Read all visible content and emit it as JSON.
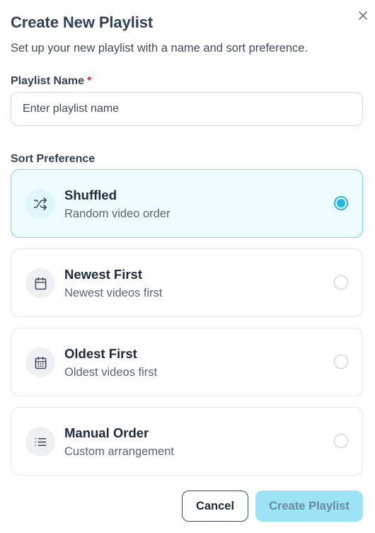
{
  "dialog": {
    "title": "Create New Playlist",
    "subtitle": "Set up your new playlist with a name and sort preference."
  },
  "name_field": {
    "label": "Playlist Name",
    "required_mark": "*",
    "placeholder": "Enter playlist name",
    "value": ""
  },
  "sort": {
    "label": "Sort Preference",
    "selected": "shuffled",
    "options": [
      {
        "id": "shuffled",
        "icon": "shuffle-icon",
        "title": "Shuffled",
        "description": "Random video order",
        "selected": true
      },
      {
        "id": "newest",
        "icon": "calendar-icon",
        "title": "Newest First",
        "description": "Newest videos first",
        "selected": false
      },
      {
        "id": "oldest",
        "icon": "calendar-days-icon",
        "title": "Oldest First",
        "description": "Oldest videos first",
        "selected": false
      },
      {
        "id": "manual",
        "icon": "list-icon",
        "title": "Manual Order",
        "description": "Custom arrangement",
        "selected": false
      }
    ]
  },
  "actions": {
    "cancel_label": "Cancel",
    "create_label": "Create Playlist",
    "create_disabled": true
  },
  "colors": {
    "accent": "#1bb9e0",
    "selected_bg": "#effcff",
    "selected_border": "#67dcf0",
    "required": "#e11d48",
    "create_button_disabled_bg": "#9be3f5"
  }
}
